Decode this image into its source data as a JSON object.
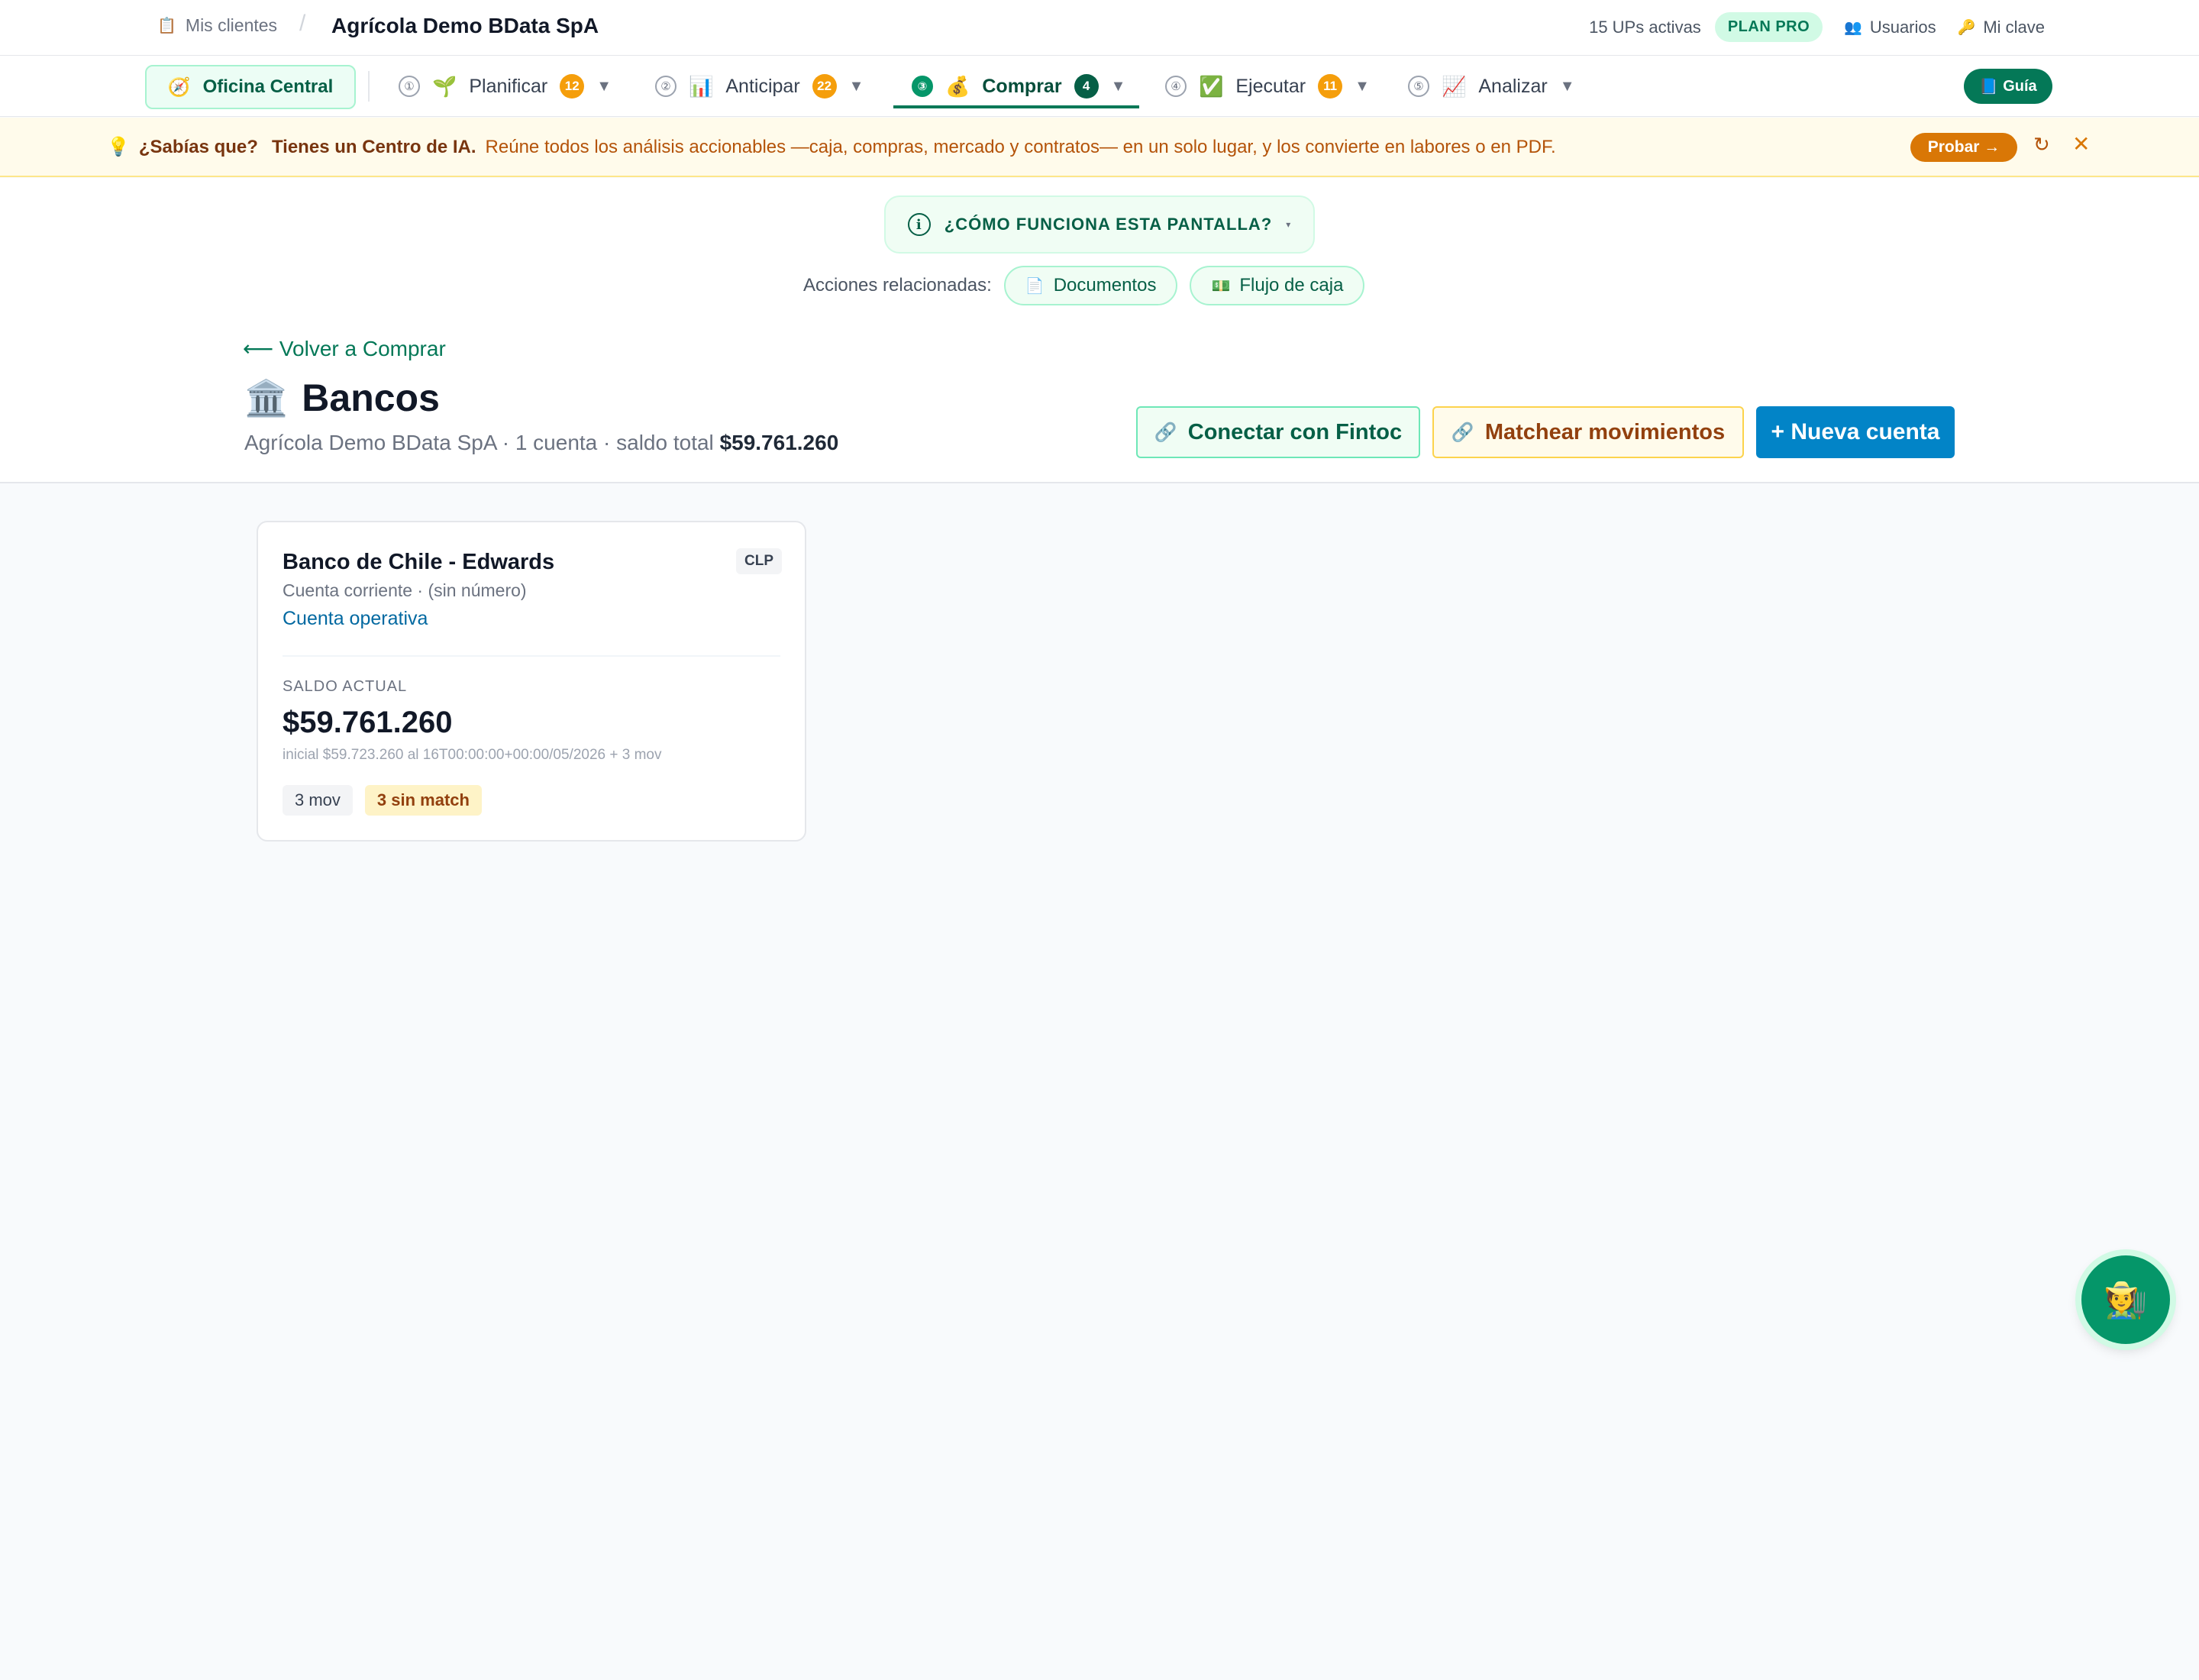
{
  "topbar": {
    "crumb_icon": "📋",
    "crumb_label": "Mis clientes",
    "separator": "/",
    "company": "Agrícola Demo BData SpA",
    "ups": "15 UPs activas",
    "plan": "PLAN PRO",
    "users_icon": "👥",
    "users": "Usuarios",
    "key_icon": "🔑",
    "key": "Mi clave"
  },
  "nav": {
    "office_icon": "🧭",
    "office": "Oficina Central",
    "items": [
      {
        "num": "①",
        "emoji": "🌱",
        "label": "Planificar",
        "badge": "12"
      },
      {
        "num": "②",
        "emoji": "📊",
        "label": "Anticipar",
        "badge": "22"
      },
      {
        "num": "③",
        "emoji": "💰",
        "label": "Comprar",
        "badge": "4"
      },
      {
        "num": "④",
        "emoji": "✅",
        "label": "Ejecutar",
        "badge": "11"
      },
      {
        "num": "⑤",
        "emoji": "📈",
        "label": "Analizar",
        "badge": ""
      }
    ],
    "caret": "▼",
    "guide_icon": "📘",
    "guide": "Guía"
  },
  "tip": {
    "icon": "💡",
    "question": "¿Sabías que?",
    "lead": "Tienes un Centro de IA.",
    "body": "Reúne todos los análisis accionables —caja, compras, mercado y contratos— en un solo lugar, y los convierte en labores o en PDF.",
    "try": "Probar →",
    "refresh": "↻",
    "close": "✕"
  },
  "help": {
    "info": "i",
    "label": "¿CÓMO FUNCIONA ESTA PANTALLA?",
    "caret": "▾"
  },
  "related": {
    "label": "Acciones relacionadas:",
    "chips": [
      {
        "icon": "📄",
        "label": "Documentos"
      },
      {
        "icon": "💵",
        "label": "Flujo de caja"
      }
    ]
  },
  "page": {
    "back": "⟵ Volver a Comprar",
    "title_icon": "🏛️",
    "title": "Bancos",
    "subtitle": "Agrícola Demo BData SpA · 1 cuenta · saldo total ",
    "total": "$59.761.260",
    "link_icon": "🔗",
    "connect": "Conectar con Fintoc",
    "match": "Matchear movimientos",
    "new": "+ Nueva cuenta"
  },
  "accounts": [
    {
      "bank": "Banco de Chile - Edwards",
      "currency": "CLP",
      "type": "Cuenta corriente · (sin número)",
      "role": "Cuenta operativa",
      "balance_label": "SALDO ACTUAL",
      "balance": "$59.761.260",
      "detail": "inicial $59.723.260 al 16T00:00:00+00:00/05/2026 + 3 mov",
      "movements": "3 mov",
      "unmatched": "3 sin match"
    }
  ],
  "assistant_icon": "🧑‍🌾",
  "colors": {
    "brand": "#047857",
    "accent_blue": "#0284c7",
    "warning": "#d97706"
  }
}
